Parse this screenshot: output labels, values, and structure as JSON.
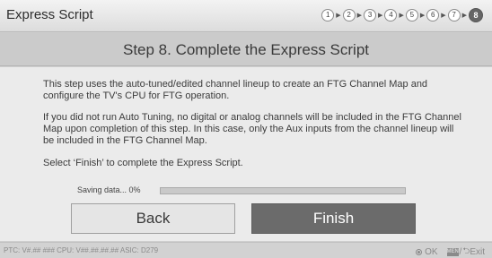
{
  "header": {
    "title": "Express Script",
    "steps": [
      "1",
      "2",
      "3",
      "4",
      "5",
      "6",
      "7",
      "8"
    ],
    "current_step": 8
  },
  "main": {
    "heading": "Step 8. Complete the Express Script",
    "paragraphs": [
      "This step uses the auto-tuned/edited channel lineup to create an FTG Channel Map and configure the TV's CPU for FTG operation.",
      "If you did not run Auto Tuning, no digital or analog channels will be included in the FTG Channel Map upon completion of this step. In this case, only the Aux inputs from the channel lineup will be included in the FTG Channel Map.",
      "Select ‘Finish’ to complete the Express Script."
    ],
    "progress": {
      "label": "Saving data... 0%",
      "percent": 0
    },
    "buttons": {
      "back": "Back",
      "finish": "Finish"
    }
  },
  "footer": {
    "info": "PTC: V#.## ### CPU: V##.##.##.## ASIC: D279",
    "ok_label": "OK",
    "menu_icon_label": "MENU",
    "exit_label": "Exit",
    "slash": "/",
    "back_arrow": "⮌"
  },
  "colors": {
    "title_bar": "#e6e6e6",
    "heading_band": "#cbcbcb",
    "content_bg": "#ebebeb",
    "finish_button": "#6b6b6b",
    "back_button": "#e5e5e5"
  },
  "icons": {
    "step_arrow": "triangle-right-icon",
    "ok": "ok-dot-icon",
    "menu": "menu-button-icon",
    "back": "return-arrow-icon"
  }
}
